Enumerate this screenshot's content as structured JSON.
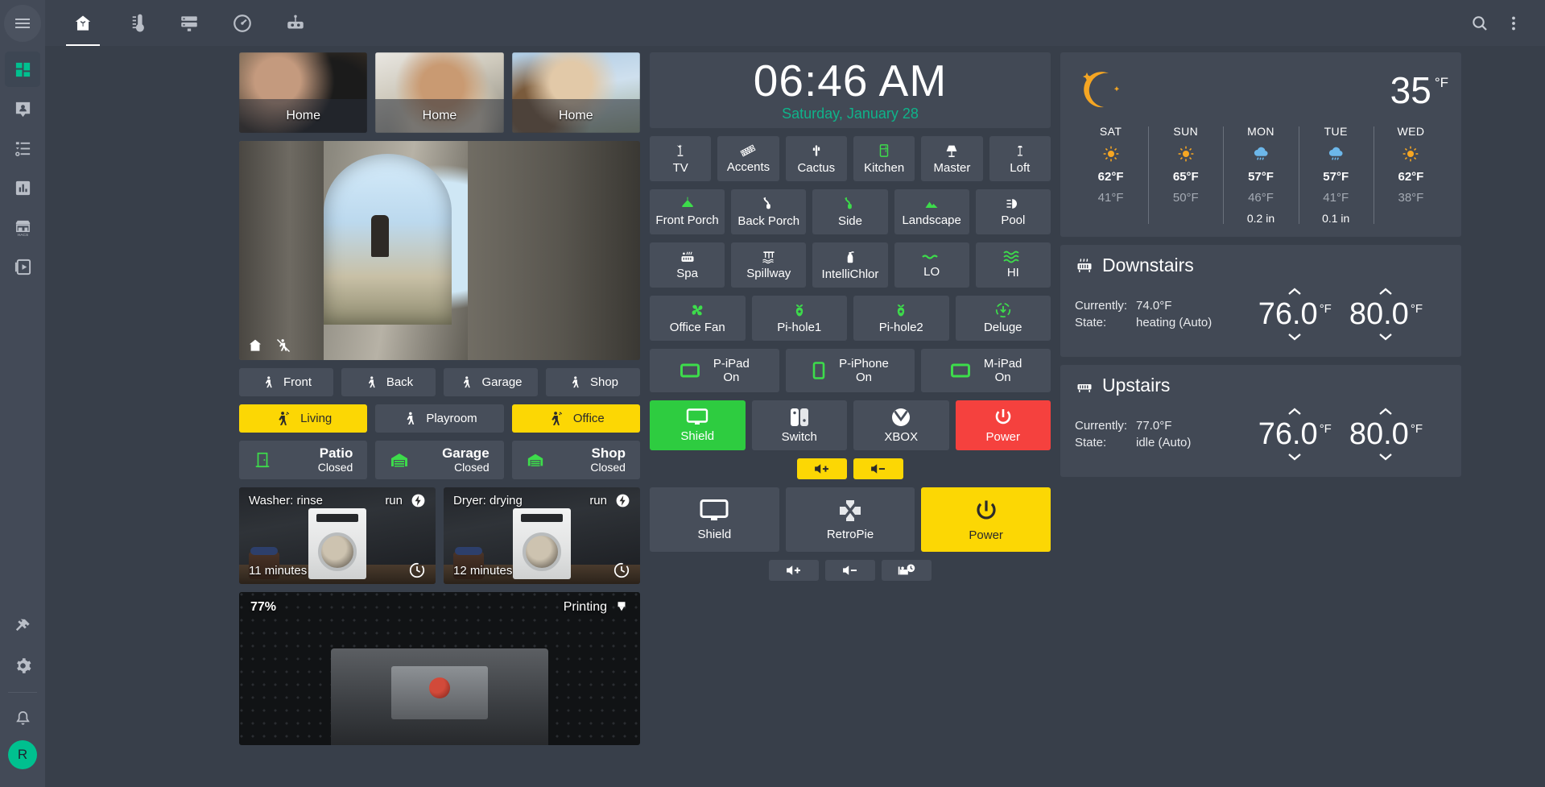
{
  "sidebar": {
    "items": [
      {
        "name": "dashboard",
        "icon": "grid-icon",
        "active": true
      },
      {
        "name": "map-person",
        "icon": "person-pin-icon",
        "active": false
      },
      {
        "name": "todo-list",
        "icon": "list-icon",
        "active": false
      },
      {
        "name": "history",
        "icon": "chart-icon",
        "active": false
      },
      {
        "name": "hacs",
        "icon": "store-icon",
        "active": false
      },
      {
        "name": "media",
        "icon": "media-play-icon",
        "active": false
      }
    ],
    "bottom": [
      {
        "name": "developer-tools",
        "icon": "hammer-icon"
      },
      {
        "name": "settings",
        "icon": "gear-icon"
      },
      {
        "name": "notifications",
        "icon": "bell-icon"
      }
    ],
    "avatar_initial": "R"
  },
  "topbar": {
    "menu_icon": "hamburger-icon",
    "tabs": [
      {
        "name": "home",
        "icon": "home-icon",
        "active": true
      },
      {
        "name": "climate",
        "icon": "thermometer-icon",
        "active": false
      },
      {
        "name": "server",
        "icon": "server-icon",
        "active": false
      },
      {
        "name": "gauge",
        "icon": "gauge-icon",
        "active": false
      },
      {
        "name": "automation",
        "icon": "robot-icon",
        "active": false
      }
    ],
    "search_icon": "search-icon",
    "overflow_icon": "dots-vertical-icon"
  },
  "people": [
    {
      "label": "Home"
    },
    {
      "label": "Home"
    },
    {
      "label": "Home"
    }
  ],
  "camera": {
    "home_icon": "home-icon",
    "motion_off_icon": "motion-sensor-off-icon"
  },
  "motion_row": [
    {
      "label": "Front",
      "icon": "walk-icon",
      "on": false
    },
    {
      "label": "Back",
      "icon": "walk-icon",
      "on": false
    },
    {
      "label": "Garage",
      "icon": "walk-icon",
      "on": false
    },
    {
      "label": "Shop",
      "icon": "walk-icon",
      "on": false
    }
  ],
  "occupancy_row": [
    {
      "label": "Living",
      "icon": "motion-sensor-icon",
      "on": true
    },
    {
      "label": "Playroom",
      "icon": "walk-icon",
      "on": false
    },
    {
      "label": "Office",
      "icon": "motion-sensor-icon",
      "on": true
    }
  ],
  "doors": [
    {
      "name": "Patio",
      "state": "Closed",
      "icon": "door-closed-icon"
    },
    {
      "name": "Garage",
      "state": "Closed",
      "icon": "garage-closed-icon"
    },
    {
      "name": "Shop",
      "state": "Closed",
      "icon": "garage-closed-icon"
    }
  ],
  "appliances": [
    {
      "title": "Washer: rinse",
      "mode": "run",
      "time": "11 minutes",
      "lightning_icon": "flash-icon",
      "clock_icon": "clock-icon"
    },
    {
      "title": "Dryer: drying",
      "mode": "run",
      "time": "12 minutes",
      "lightning_icon": "flash-icon",
      "clock_icon": "clock-icon"
    }
  ],
  "printer": {
    "percent": "77%",
    "state": "Printing",
    "state_icon": "printer-3d-nozzle-icon"
  },
  "clock": {
    "time": "06:46 AM",
    "date": "Saturday, January 28"
  },
  "light_grid": {
    "row1": [
      {
        "label": "TV",
        "icon": "floor-lamp-icon",
        "on": false
      },
      {
        "label": "Accents",
        "icon": "led-strip-icon",
        "on": false
      },
      {
        "label": "Cactus",
        "icon": "cactus-icon",
        "on": false
      },
      {
        "label": "Kitchen",
        "icon": "fridge-icon",
        "on": true
      },
      {
        "label": "Master",
        "icon": "lamp-icon",
        "on": false
      },
      {
        "label": "Loft",
        "icon": "torchiere-icon",
        "on": false
      }
    ],
    "row2": [
      {
        "label": "Front Porch",
        "icon": "ceiling-light-icon",
        "on": true
      },
      {
        "label": "Back Porch",
        "icon": "outdoor-lamp-icon",
        "on": false
      },
      {
        "label": "Side",
        "icon": "outdoor-lamp-icon",
        "on": true
      },
      {
        "label": "Landscape",
        "icon": "mountain-icon",
        "on": true
      },
      {
        "label": "Pool",
        "icon": "pool-light-icon",
        "on": false
      }
    ],
    "row3": [
      {
        "label": "Spa",
        "icon": "hot-tub-icon",
        "on": false
      },
      {
        "label": "Spillway",
        "icon": "waterfall-icon",
        "on": false
      },
      {
        "label": "IntelliChlor",
        "icon": "spray-bottle-icon",
        "on": false
      },
      {
        "label": "LO",
        "icon": "wave-icon",
        "on": true
      },
      {
        "label": "HI",
        "icon": "waves-icon",
        "on": true
      }
    ],
    "row4": [
      {
        "label": "Office Fan",
        "icon": "fan-icon",
        "on": true
      },
      {
        "label": "Pi-hole1",
        "icon": "pi-hole-icon",
        "on": true
      },
      {
        "label": "Pi-hole2",
        "icon": "pi-hole-icon",
        "on": true
      },
      {
        "label": "Deluge",
        "icon": "download-circle-icon",
        "on": true
      }
    ],
    "row5": [
      {
        "label_top": "P-iPad",
        "label_bottom": "On",
        "icon": "tablet-icon",
        "on": true
      },
      {
        "label_top": "P-iPhone",
        "label_bottom": "On",
        "icon": "phone-icon",
        "on": true
      },
      {
        "label_top": "M-iPad",
        "label_bottom": "On",
        "icon": "tablet-icon",
        "on": true
      }
    ]
  },
  "media_primary": {
    "buttons": [
      {
        "label": "Shield",
        "icon": "monitor-icon",
        "state": "green"
      },
      {
        "label": "Switch",
        "icon": "nintendo-switch-icon",
        "state": "off"
      },
      {
        "label": "XBOX",
        "icon": "xbox-icon",
        "state": "off"
      },
      {
        "label": "Power",
        "icon": "power-icon",
        "state": "red"
      }
    ],
    "volume": [
      {
        "name": "volume-up",
        "icon": "volume-plus-icon",
        "state": "yellow"
      },
      {
        "name": "volume-down",
        "icon": "volume-minus-icon",
        "state": "yellow"
      }
    ]
  },
  "media_secondary": {
    "buttons": [
      {
        "label": "Shield",
        "icon": "monitor-icon",
        "state": "off"
      },
      {
        "label": "RetroPie",
        "icon": "gamepad-dpad-icon",
        "state": "off"
      },
      {
        "label": "Power",
        "icon": "power-icon",
        "state": "yellow"
      }
    ],
    "volume": [
      {
        "name": "volume-up",
        "icon": "volume-plus-icon",
        "state": "off"
      },
      {
        "name": "volume-down",
        "icon": "volume-minus-icon",
        "state": "off"
      },
      {
        "name": "sleep-timer",
        "icon": "bed-clock-icon",
        "state": "off"
      }
    ]
  },
  "weather": {
    "current_icon": "night-clear-icon",
    "current_temp": "35",
    "current_unit": "°F",
    "forecast": [
      {
        "day": "SAT",
        "icon": "sunny-icon",
        "high": "62°F",
        "low": "41°F",
        "precip": ""
      },
      {
        "day": "SUN",
        "icon": "sunny-icon",
        "high": "65°F",
        "low": "50°F",
        "precip": ""
      },
      {
        "day": "MON",
        "icon": "rainy-icon",
        "high": "57°F",
        "low": "46°F",
        "precip": "0.2 in"
      },
      {
        "day": "TUE",
        "icon": "rainy-icon",
        "high": "57°F",
        "low": "41°F",
        "precip": "0.1 in"
      },
      {
        "day": "WED",
        "icon": "sunny-icon",
        "high": "62°F",
        "low": "38°F",
        "precip": ""
      }
    ]
  },
  "thermostats": [
    {
      "title": "Downstairs",
      "icon": "radiator-icon",
      "currently_label": "Currently:",
      "currently_value": "74.0°F",
      "state_label": "State:",
      "state_value": "heating (Auto)",
      "setpoint_low": "76.0",
      "setpoint_high": "80.0",
      "unit": "°F"
    },
    {
      "title": "Upstairs",
      "icon": "radiator-off-icon",
      "currently_label": "Currently:",
      "currently_value": "77.0°F",
      "state_label": "State:",
      "state_value": "idle (Auto)",
      "setpoint_low": "76.0",
      "setpoint_high": "80.0",
      "unit": "°F"
    }
  ],
  "colors": {
    "accent": "#0fb38a",
    "on_yellow": "#fcd704",
    "on_green": "#3ddc4b",
    "off_red": "#f5413e",
    "card_bg": "#424955",
    "page_bg": "#383f4a"
  }
}
